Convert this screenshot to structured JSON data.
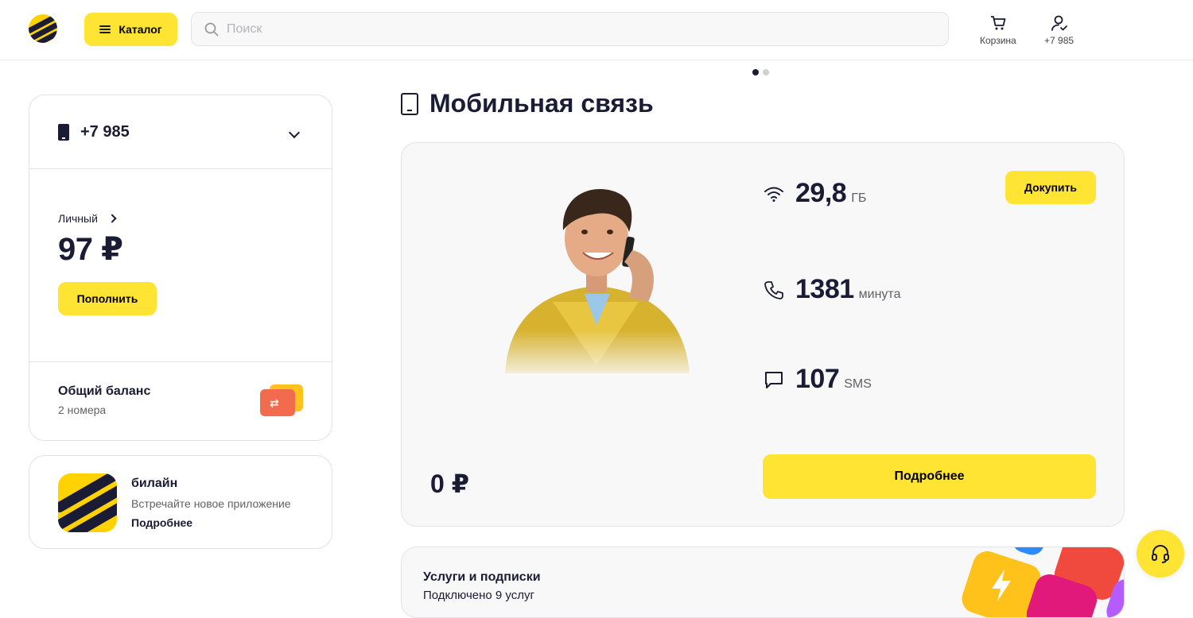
{
  "header": {
    "catalog_label": "Каталог",
    "search_placeholder": "Поиск",
    "cart_label": "Корзина",
    "profile_label": "+7 985"
  },
  "carousel": {
    "pages": 2,
    "active": 1
  },
  "account": {
    "number": "+7 985",
    "type_label": "Личный",
    "balance": "97 ₽",
    "topup_label": "Пополнить",
    "shared_title": "Общий баланс",
    "shared_sub": "2 номера"
  },
  "app_promo": {
    "title": "билайн",
    "subtitle": "Встречайте новое приложение",
    "link": "Подробнее"
  },
  "mobile": {
    "section_title": "Мобильная связь",
    "price": "0 ₽",
    "buy_label": "Докупить",
    "more_label": "Подробнее",
    "stats": [
      {
        "icon": "wifi-icon",
        "value": "29,8",
        "unit": "ГБ"
      },
      {
        "icon": "phone-call-icon",
        "value": "1381",
        "unit": "минута"
      },
      {
        "icon": "message-icon",
        "value": "107",
        "unit": "SMS"
      }
    ]
  },
  "services": {
    "title": "Услуги и подписки",
    "subtitle": "Подключено 9 услуг"
  },
  "colors": {
    "brand_yellow": "#ffe433",
    "dark": "#191c34",
    "card_bg": "#f8f8f8"
  }
}
